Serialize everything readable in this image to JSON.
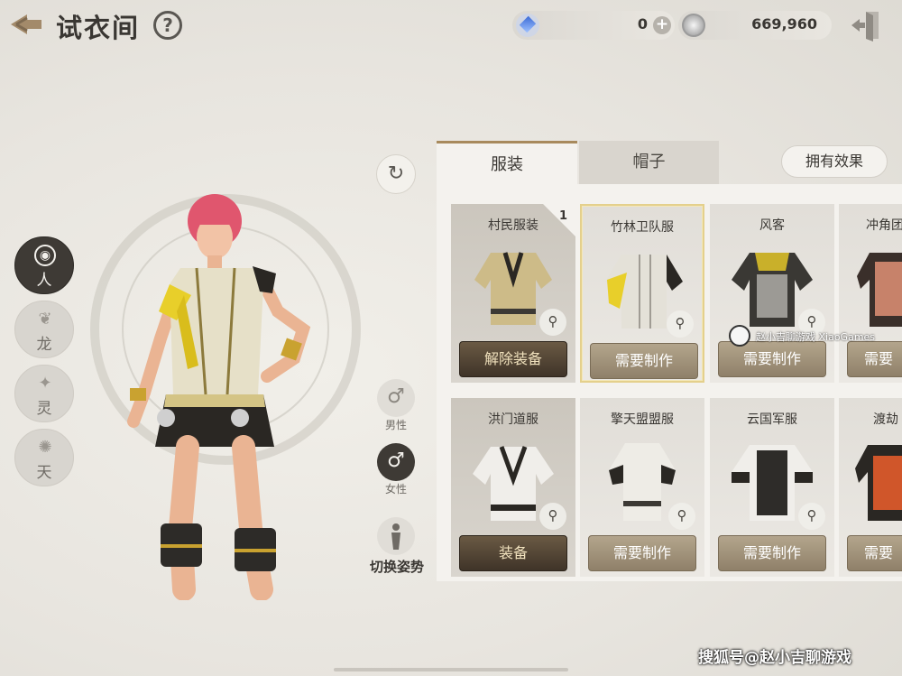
{
  "header": {
    "title": "试衣间",
    "help_label": "?",
    "currency_gem": "0",
    "currency_gem_add": "+",
    "currency_coin": "669,960"
  },
  "races": [
    {
      "glyph": "人",
      "label": "人",
      "active": true
    },
    {
      "glyph": "龙",
      "label": "龙",
      "active": false
    },
    {
      "glyph": "灵",
      "label": "灵",
      "active": false
    },
    {
      "glyph": "天",
      "label": "天",
      "active": false
    }
  ],
  "controls": {
    "rotate_icon": "↻",
    "male_icon": "♂",
    "male_label": "男性",
    "female_icon": "♂",
    "female_label": "女性",
    "pose_label": "切换姿势"
  },
  "tabs": {
    "costume": "服装",
    "hat": "帽子",
    "effect_button": "拥有效果"
  },
  "costumes": [
    {
      "name": "村民服装",
      "count": "1",
      "action": "解除装备",
      "style": "dark"
    },
    {
      "name": "竹林卫队服",
      "action": "需要制作",
      "style": "light",
      "selected": true
    },
    {
      "name": "风客",
      "action": "需要制作",
      "style": "light"
    },
    {
      "name": "冲角团",
      "action": "需要",
      "style": "light"
    },
    {
      "name": "洪门道服",
      "action": "装备",
      "style": "dark"
    },
    {
      "name": "擎天盟盟服",
      "action": "需要制作",
      "style": "light"
    },
    {
      "name": "云国军服",
      "action": "需要制作",
      "style": "light"
    },
    {
      "name": "渡劫",
      "action": "需要",
      "style": "light"
    }
  ],
  "watermarks": {
    "overlay": "赵小吉聊游戏 XiaoGames",
    "footer": "搜狐号@赵小吉聊游戏"
  },
  "colors": {
    "accent_gold": "#a88a5d",
    "action_dark": "#3f3428",
    "action_light": "#8f8069",
    "selected_border": "#e4d08c"
  },
  "icons": [
    "back-arrow-icon",
    "help-icon",
    "gem-icon",
    "coin-icon",
    "exit-door-icon",
    "rotate-icon",
    "male-icon",
    "female-icon",
    "pose-icon",
    "zoom-icon"
  ]
}
